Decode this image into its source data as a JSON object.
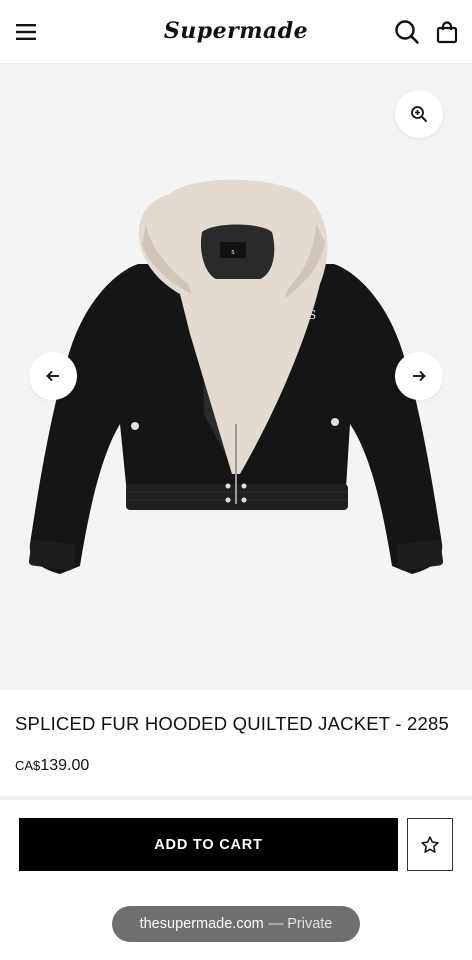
{
  "header": {
    "brand": "Supermade",
    "menu_icon": "hamburger-menu-icon",
    "search_icon": "search-icon",
    "cart_icon": "shopping-bag-icon"
  },
  "gallery": {
    "zoom_icon": "zoom-in-icon",
    "prev_icon": "arrow-left-icon",
    "next_icon": "arrow-right-icon",
    "background": "#f4f4f4"
  },
  "product": {
    "title": "SPLICED FUR HOODED QUILTED JACKET - 2285",
    "currency": "CA$",
    "amount": "139.00"
  },
  "actions": {
    "add_to_cart": "ADD TO CART",
    "wishlist_icon": "star-icon"
  },
  "browser": {
    "domain": "thesupermade.com",
    "mode": "— Private"
  }
}
